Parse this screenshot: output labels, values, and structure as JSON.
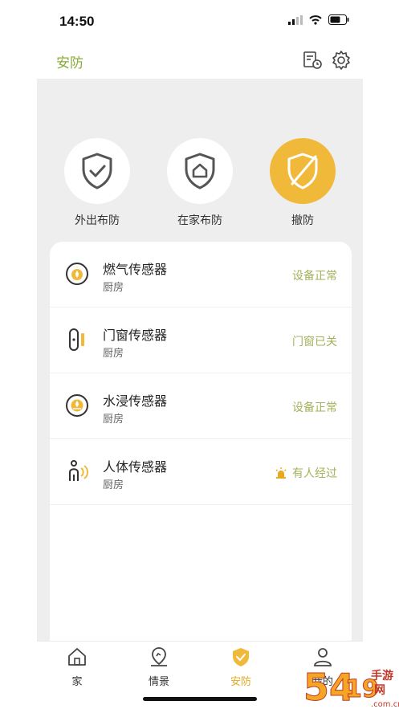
{
  "status_bar": {
    "time": "14:50"
  },
  "header": {
    "title": "安防"
  },
  "modes": [
    {
      "label": "外出布防",
      "icon": "shield-check-icon"
    },
    {
      "label": "在家布防",
      "icon": "shield-home-icon"
    },
    {
      "label": "撤防",
      "icon": "shield-off-icon",
      "active": true
    }
  ],
  "devices": [
    {
      "name": "燃气传感器",
      "room": "厨房",
      "status": "设备正常",
      "icon": "gas-sensor-icon"
    },
    {
      "name": "门窗传感器",
      "room": "厨房",
      "status": "门窗已关",
      "icon": "door-sensor-icon"
    },
    {
      "name": "水浸传感器",
      "room": "厨房",
      "status": "设备正常",
      "icon": "water-sensor-icon"
    },
    {
      "name": "人体传感器",
      "room": "厨房",
      "status": "有人经过",
      "icon": "motion-sensor-icon"
    }
  ],
  "tabs": [
    {
      "label": "家",
      "icon": "home-icon"
    },
    {
      "label": "情景",
      "icon": "scene-icon"
    },
    {
      "label": "安防",
      "icon": "security-icon",
      "active": true
    },
    {
      "label": "我的",
      "icon": "user-icon"
    }
  ],
  "watermark": "5419手游网",
  "colors": {
    "accent_green": "#8bab3a",
    "accent_yellow": "#f1b93a",
    "status_text": "#a5b15a"
  }
}
